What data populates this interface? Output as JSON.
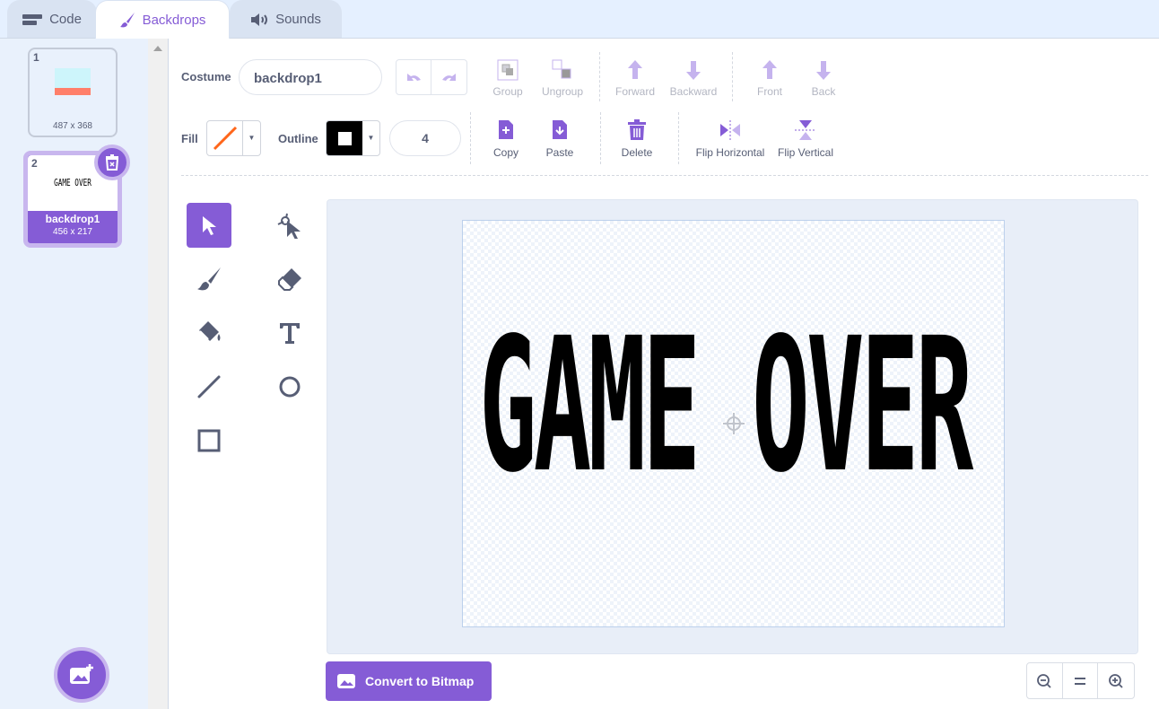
{
  "tabs": [
    {
      "label": "Code",
      "icon": "code-icon"
    },
    {
      "label": "Backdrops",
      "icon": "brush-icon",
      "active": true
    },
    {
      "label": "Sounds",
      "icon": "speaker-icon"
    }
  ],
  "backdrops": [
    {
      "index": "1",
      "size": "487 x 368"
    },
    {
      "index": "2",
      "name": "backdrop1",
      "size": "456 x 217",
      "preview": "GAME OVER",
      "selected": true
    }
  ],
  "toolbar": {
    "costume_label": "Costume",
    "costume_name": "backdrop1",
    "group": "Group",
    "ungroup": "Ungroup",
    "forward": "Forward",
    "backward": "Backward",
    "front": "Front",
    "back": "Back",
    "fill_label": "Fill",
    "fill_color": "none",
    "outline_label": "Outline",
    "outline_color": "#000000",
    "outline_width": "4",
    "copy": "Copy",
    "paste": "Paste",
    "delete": "Delete",
    "flip_h": "Flip Horizontal",
    "flip_v": "Flip Vertical"
  },
  "canvas": {
    "text": "GAME OVER"
  },
  "convert_label": "Convert to Bitmap",
  "colors": {
    "accent": "#855cd6",
    "text": "#575e75"
  }
}
